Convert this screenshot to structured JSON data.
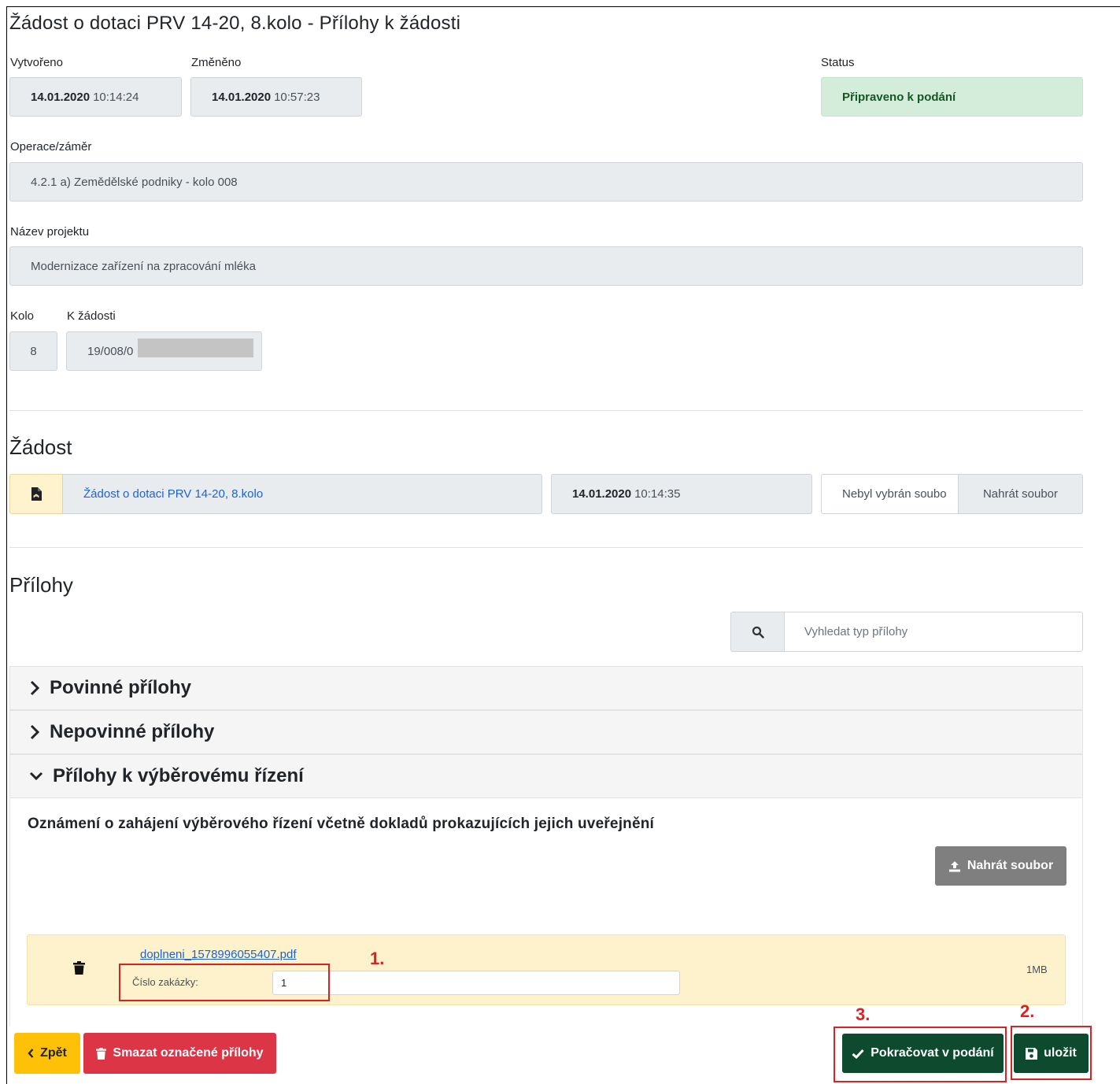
{
  "header": {
    "title": "Žádost o dotaci PRV 14-20, 8.kolo - Přílohy k žádosti"
  },
  "meta": {
    "created_label": "Vytvořeno",
    "created_date": "14.01.2020",
    "created_time": "10:14:24",
    "changed_label": "Změněno",
    "changed_date": "14.01.2020",
    "changed_time": "10:57:23",
    "status_label": "Status",
    "status_value": "Připraveno k podání",
    "status_color": "#d4edda"
  },
  "operation": {
    "label": "Operace/záměr",
    "value": "4.2.1 a) Zemědělské podniky - kolo 008"
  },
  "project": {
    "label": "Název projektu",
    "value": "Modernizace zařízení na zpracování mléka"
  },
  "round": {
    "label": "Kolo",
    "value": "8",
    "request_label": "K žádosti",
    "request_value": "19/008/0"
  },
  "request_section": {
    "heading": "Žádost",
    "file_icon": "pdf-file-icon",
    "link_text": "Žádost o dotaci PRV 14-20, 8.kolo",
    "date": "14.01.2020",
    "time": "10:14:35",
    "file_placeholder": "Nebyl vybrán soubo",
    "upload_label": "Nahrát soubor"
  },
  "attachments": {
    "heading": "Přílohy",
    "search_placeholder": "Vyhledat typ přílohy",
    "groups": [
      {
        "label": "Povinné přílohy",
        "expanded": false
      },
      {
        "label": "Nepovinné přílohy",
        "expanded": false
      },
      {
        "label": "Přílohy k výběrovému řízení",
        "expanded": true
      }
    ],
    "item_title": "Oznámení o zahájení výběrového řízení včetně dokladů prokazujících jejich uveřejnění",
    "upload_label": "Nahrát soubor",
    "file": {
      "name": "doplneni_1578996055407.pdf",
      "order_label": "Číslo zakázky:",
      "order_value": "1",
      "size": "1MB"
    }
  },
  "annotations": {
    "step1": "1.",
    "step2": "2.",
    "step3": "3."
  },
  "footer": {
    "back_label": "Zpět",
    "delete_label": "Smazat označené přílohy",
    "continue_label": "Pokračovat v podání",
    "save_label": "uložit"
  }
}
